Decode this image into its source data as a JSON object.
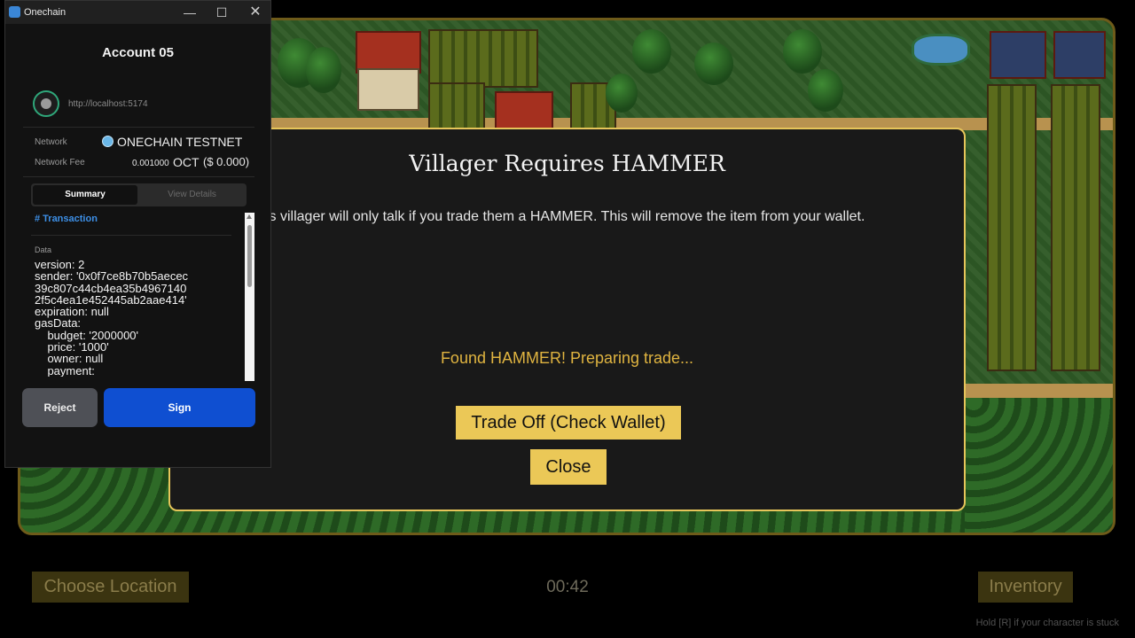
{
  "wallet": {
    "app_title": "Onechain",
    "window_controls": {
      "minimize": "—",
      "maximize": "☐",
      "close": "✕"
    },
    "account": "Account 05",
    "origin_url": "http://localhost:5174",
    "network_label": "Network",
    "network_value": "ONECHAIN TESTNET",
    "fee_label": "Network Fee",
    "fee_amount": "0.001000",
    "fee_unit": "OCT",
    "fee_usd": "($ 0.000)",
    "tabs": {
      "summary": "Summary",
      "details": "View Details"
    },
    "transaction_header": "# Transaction",
    "data_label": "Data",
    "data_text": "version: 2\nsender: '0x0f7ce8b70b5aecec\n39c807c44cb4ea35b4967140\n2f5c4ea1e452445ab2aae414'\nexpiration: null\ngasData:\n    budget: '2000000'\n    price: '1000'\n    owner: null\n    payment:",
    "reject_label": "Reject",
    "sign_label": "Sign"
  },
  "dialog": {
    "title": "Villager Requires HAMMER",
    "message": "s villager will only talk if you trade them a HAMMER. This will remove the item from your wallet.",
    "status": "Found HAMMER! Preparing trade...",
    "trade_label": "Trade Off (Check Wallet)",
    "close_label": "Close"
  },
  "bottom_bar": {
    "choose_location": "Choose Location",
    "timer": "00:42",
    "inventory": "Inventory",
    "hint": "Hold [R] if your character is stuck"
  },
  "colors": {
    "accent_gold": "#ebc857",
    "sign_blue": "#0f4fd1",
    "link_blue": "#3d8fe6"
  }
}
